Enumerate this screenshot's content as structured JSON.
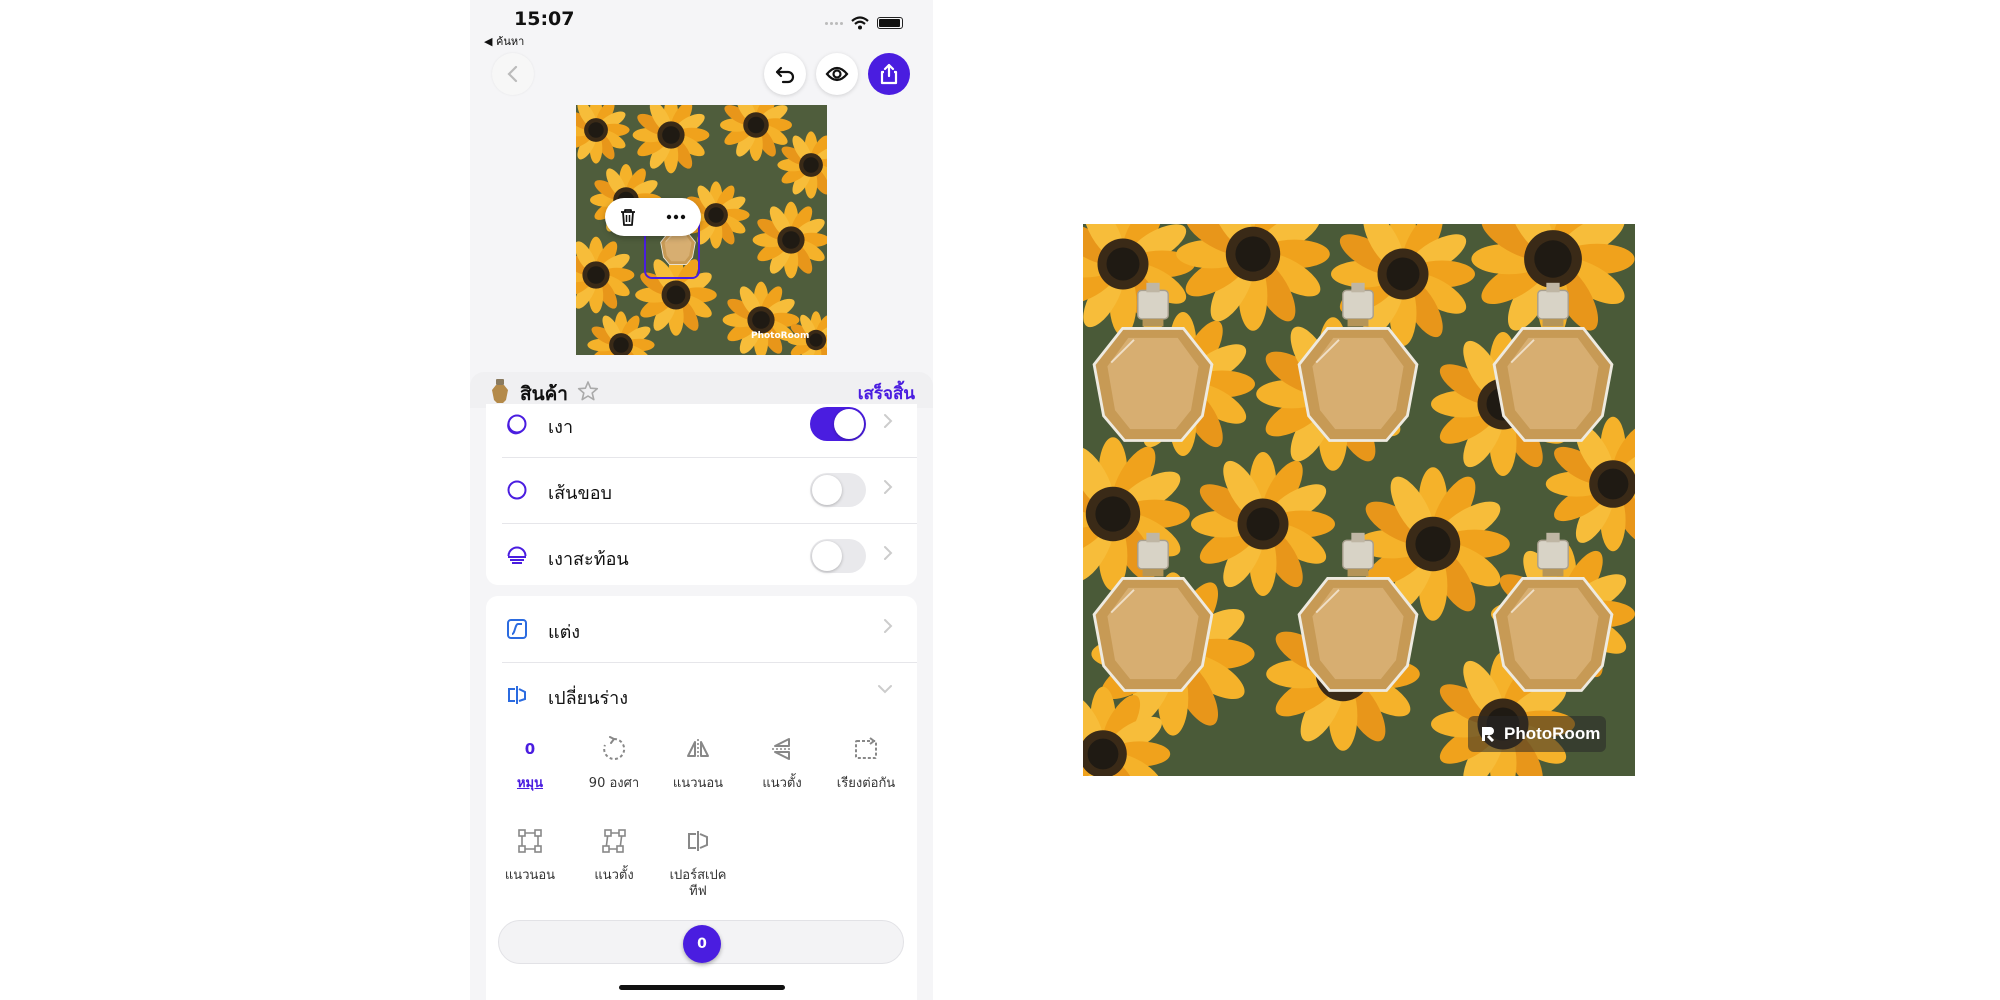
{
  "status_bar": {
    "time": "15:07",
    "back_label": "◀ ค้นหา"
  },
  "product": {
    "title": "สินค้า",
    "done_label": "เสร็จสิ้น"
  },
  "effects": [
    {
      "label": "เงา",
      "on": true
    },
    {
      "label": "เส้นขอบ",
      "on": false
    },
    {
      "label": "เงาสะท้อน",
      "on": false
    }
  ],
  "menu": {
    "adjust_label": "แต่ง",
    "transform_label": "เปลี่ยนร่าง"
  },
  "transform_tools": {
    "rotate_value": "0",
    "rotate_label": "หมุน",
    "rotate90_label": "90 องศา",
    "flip_h_label": "แนวนอน",
    "flip_v_label": "แนวตั้ง",
    "tile_label": "เรียงต่อกัน",
    "skew_h_label": "แนวนอน",
    "skew_v_label": "แนวตั้ง",
    "perspective_label": "เปอร์สเปค\nทีฟ"
  },
  "slider": {
    "value": "0"
  },
  "watermark": {
    "text": "PhotoRoom"
  },
  "colors": {
    "accent": "#4a1de0",
    "sunflower": "#f2a91e",
    "background": "#f5f5f7"
  }
}
